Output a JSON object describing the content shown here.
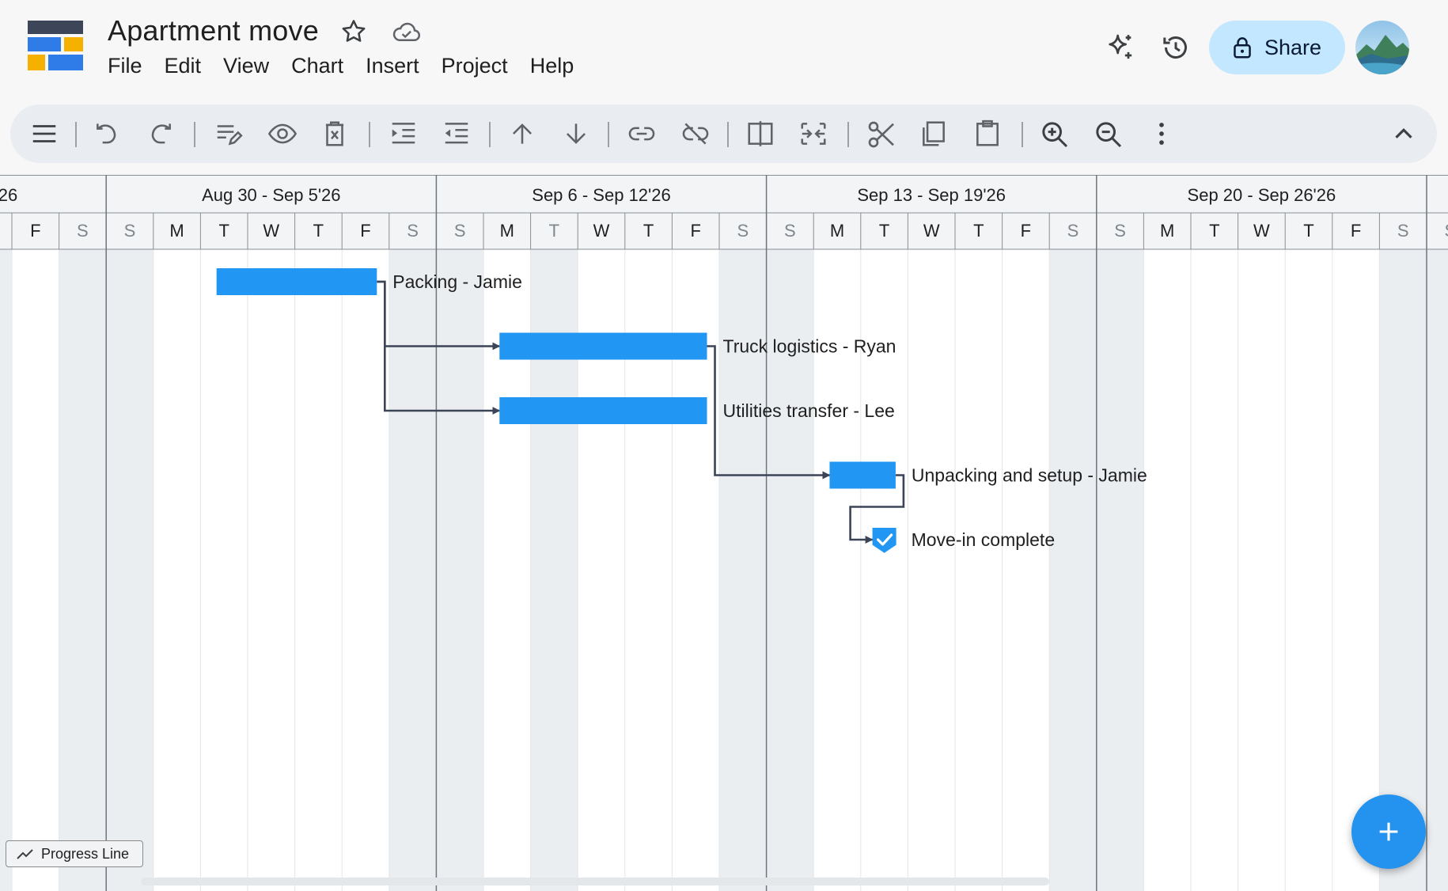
{
  "app": {
    "title": "Apartment move",
    "menus": [
      "File",
      "Edit",
      "View",
      "Chart",
      "Insert",
      "Project",
      "Help"
    ],
    "share_label": "Share",
    "brand_color": "#2196f3",
    "icons": {
      "star": "star-outline-icon",
      "cloud": "cloud-saved-icon",
      "gemini": "sparkle-icon",
      "history": "history-icon",
      "share": "lock-icon"
    }
  },
  "toolbar": {
    "buttons": [
      {
        "name": "menu-icon"
      },
      {
        "name": "undo-icon"
      },
      {
        "name": "redo-icon"
      },
      {
        "name": "edit-task-icon"
      },
      {
        "name": "visibility-icon"
      },
      {
        "name": "delete-icon"
      },
      {
        "name": "indent-icon"
      },
      {
        "name": "outdent-icon"
      },
      {
        "name": "move-up-icon"
      },
      {
        "name": "move-down-icon"
      },
      {
        "name": "link-icon"
      },
      {
        "name": "unlink-icon"
      },
      {
        "name": "split-icon"
      },
      {
        "name": "merge-icon"
      },
      {
        "name": "cut-icon"
      },
      {
        "name": "copy-icon"
      },
      {
        "name": "paste-icon"
      },
      {
        "name": "zoom-in-icon"
      },
      {
        "name": "zoom-out-icon"
      },
      {
        "name": "more-vert-icon"
      },
      {
        "name": "collapse-toolbar-icon"
      }
    ]
  },
  "timeline": {
    "weeks": [
      {
        "label": "26"
      },
      {
        "label": "Aug 30 - Sep 5'26"
      },
      {
        "label": "Sep 6 - Sep 12'26"
      },
      {
        "label": "Sep 13 - Sep 19'26"
      },
      {
        "label": "Sep 20 - Sep 26'26"
      }
    ],
    "days": [
      "F",
      "S",
      "S",
      "M",
      "T",
      "W",
      "T",
      "F",
      "S",
      "S",
      "M",
      "T",
      "W",
      "T",
      "F",
      "S",
      "S",
      "M",
      "T",
      "W",
      "T",
      "F",
      "S",
      "S",
      "M",
      "T",
      "W",
      "T",
      "F",
      "S",
      "S"
    ],
    "disabled_day_index": 11
  },
  "chart_data": {
    "type": "gantt",
    "tasks": [
      {
        "label": "Packing - Jamie",
        "start": "2026-09-01",
        "duration_days": 3.4
      },
      {
        "label": "Truck logistics - Ryan",
        "start": "2026-09-07",
        "duration_days": 4.4
      },
      {
        "label": "Utilities transfer - Lee",
        "start": "2026-09-07",
        "duration_days": 4.4
      },
      {
        "label": "Unpacking and setup - Jamie",
        "start": "2026-09-14",
        "duration_days": 1.4
      },
      {
        "label": "Move-in complete",
        "milestone": true,
        "date": "2026-09-15"
      }
    ],
    "dependencies": [
      [
        0,
        1
      ],
      [
        0,
        2
      ],
      [
        1,
        3
      ],
      [
        3,
        4
      ]
    ]
  },
  "controls": {
    "progress_line_label": "Progress Line",
    "fab": "add-icon"
  }
}
